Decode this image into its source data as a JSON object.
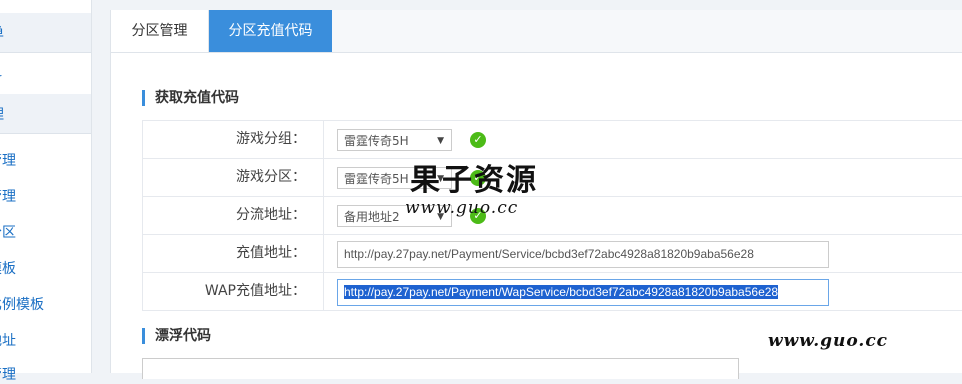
{
  "sidebar": {
    "items": [
      {
        "label": "单"
      },
      {
        "label": "科"
      },
      {
        "label": "理"
      },
      {
        "label": "管理"
      },
      {
        "label": "管理"
      },
      {
        "label": "分区"
      },
      {
        "label": "模板"
      },
      {
        "label": "比例模板"
      },
      {
        "label": "地址"
      },
      {
        "label": "管理"
      }
    ]
  },
  "tabs": [
    {
      "label": "分区管理"
    },
    {
      "label": "分区充值代码"
    }
  ],
  "section1": {
    "title": "获取充值代码"
  },
  "form": {
    "group": {
      "label": "游戏分组：",
      "value": "雷霆传奇5H"
    },
    "zone": {
      "label": "游戏分区：",
      "value": "雷霆传奇5H"
    },
    "route": {
      "label": "分流地址：",
      "value": "备用地址2"
    },
    "pay": {
      "label": "充值地址：",
      "value": "http://pay.27pay.net/Payment/Service/bcbd3ef72abc4928a81820b9aba56e28"
    },
    "wap": {
      "label": "WAP充值地址：",
      "value": "http://pay.27pay.net/Payment/WapService/bcbd3ef72abc4928a81820b9aba56e28"
    }
  },
  "section2": {
    "title": "漂浮代码"
  },
  "watermark": {
    "cn": "果子资源",
    "url": "www.guo.cc",
    "url2": "www.guo.cc"
  },
  "colors": {
    "accent": "#3a8edc",
    "ok": "#4cbb17",
    "link": "#1a6fc4"
  }
}
